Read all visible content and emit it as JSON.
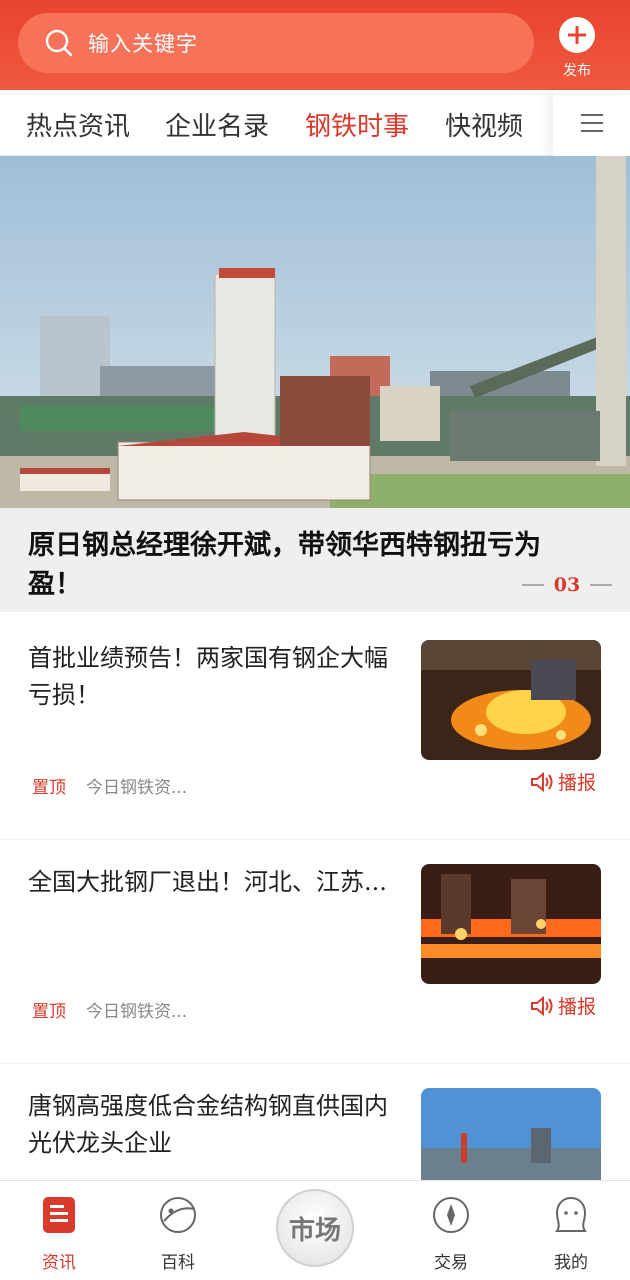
{
  "header": {
    "search_placeholder": "输入关键字",
    "publish_label": "发布"
  },
  "tabs": [
    {
      "label": "热点资讯",
      "active": false
    },
    {
      "label": "企业名录",
      "active": false
    },
    {
      "label": "钢铁时事",
      "active": true
    },
    {
      "label": "快视频",
      "active": false
    }
  ],
  "banner": {
    "title": "原日钢总经理徐开斌，带领华西特钢扭亏为盈！",
    "page": "03"
  },
  "news": [
    {
      "title": "首批业绩预告！两家国有钢企大幅亏损！",
      "pin": "置顶",
      "source": "今日钢铁资...",
      "play": "播报"
    },
    {
      "title": "全国大批钢厂退出！河北、江苏...",
      "pin": "置顶",
      "source": "今日钢铁资...",
      "play": "播报"
    },
    {
      "title": "唐钢高强度低合金结构钢直供国内光伏龙头企业",
      "pin": "",
      "source": "",
      "play": ""
    }
  ],
  "bottom_nav": [
    {
      "label": "资讯",
      "active": true
    },
    {
      "label": "百科",
      "active": false
    },
    {
      "label": "市场",
      "active": false
    },
    {
      "label": "交易",
      "active": false
    },
    {
      "label": "我的",
      "active": false
    }
  ],
  "colors": {
    "accent": "#d83a2b",
    "header": "#ee4f37"
  }
}
